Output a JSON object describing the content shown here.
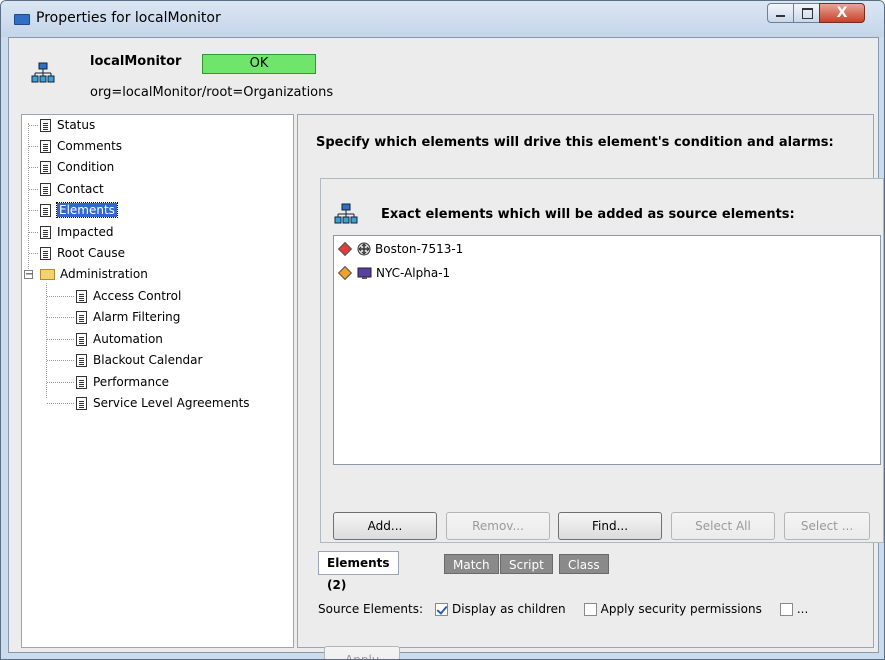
{
  "window": {
    "title": "Properties for localMonitor",
    "close_glyph": "X"
  },
  "header": {
    "element_name": "localMonitor",
    "status": "OK",
    "org_path": "org=localMonitor/root=Organizations"
  },
  "tree": {
    "items": [
      {
        "label": "Status"
      },
      {
        "label": "Comments"
      },
      {
        "label": "Condition"
      },
      {
        "label": "Contact"
      },
      {
        "label": "Elements",
        "selected": true
      },
      {
        "label": "Impacted"
      },
      {
        "label": "Root Cause"
      }
    ],
    "folder": {
      "label": "Administration",
      "expander": "−"
    },
    "sub_items": [
      {
        "label": "Access Control"
      },
      {
        "label": "Alarm Filtering"
      },
      {
        "label": "Automation"
      },
      {
        "label": "Blackout Calendar"
      },
      {
        "label": "Performance"
      },
      {
        "label": "Service Level Agreements"
      }
    ]
  },
  "panel": {
    "instruction": "Specify which elements will drive this element's condition and alarms:",
    "group_title": "Exact elements which will be added as source elements:",
    "elements": [
      {
        "label": "Boston-7513-1",
        "severity_color": "#e23b3b",
        "icon": "router-icon"
      },
      {
        "label": "NYC-Alpha-1",
        "severity_color": "#f0a030",
        "icon": "monitor-icon"
      }
    ],
    "buttons": {
      "add": "Add...",
      "remove": "Remov...",
      "find": "Find...",
      "select_all": "Select All",
      "select": "Select ..."
    },
    "tabs": {
      "elements": "Elements (2)",
      "match": "Match",
      "script": "Script",
      "class": "Class"
    },
    "source_elements_label": "Source Elements:",
    "display_as_children": "Display as children",
    "apply_security": "Apply security permissions",
    "more": "...",
    "apply": "Apply"
  }
}
